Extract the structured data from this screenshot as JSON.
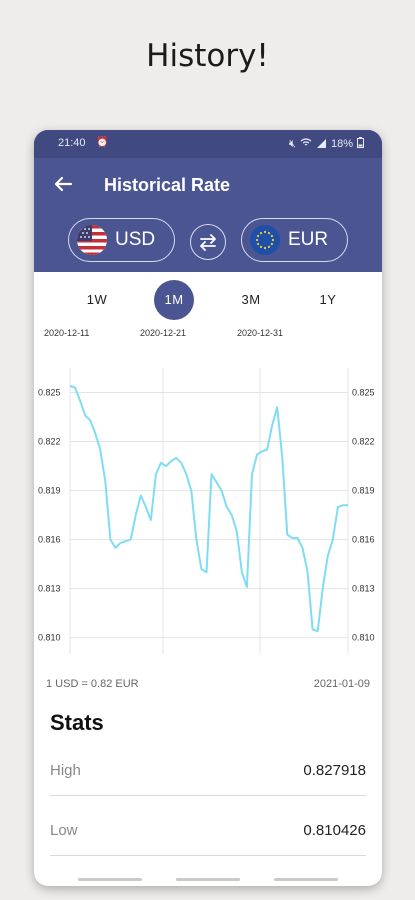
{
  "headline": "History!",
  "status": {
    "time": "21:40",
    "alarm_icon": "alarm-icon",
    "battery": "18%"
  },
  "header": {
    "title": "Historical Rate",
    "back_icon": "arrow-left-icon"
  },
  "currencies": {
    "from": {
      "code": "USD",
      "flag": "us-flag-icon"
    },
    "to": {
      "code": "EUR",
      "flag": "eu-flag-icon"
    },
    "swap_icon": "swap-arrows-icon"
  },
  "ranges": [
    {
      "label": "1W",
      "active": false
    },
    {
      "label": "1M",
      "active": true
    },
    {
      "label": "3M",
      "active": false
    },
    {
      "label": "1Y",
      "active": false
    }
  ],
  "colors": {
    "header": "#4b5591",
    "status_bar": "#414a80",
    "line": "#7fdcf4",
    "background": "#efedeb"
  },
  "chart_data": {
    "type": "line",
    "x_ticks": [
      "2020-12-11",
      "2020-12-21",
      "2020-12-31"
    ],
    "y_ticks": [
      "0.825",
      "0.822",
      "0.819",
      "0.816",
      "0.813",
      "0.810"
    ],
    "ylim": [
      0.809,
      0.8265
    ],
    "xlim": [
      0,
      29
    ],
    "grid": true,
    "series": [
      {
        "values": [
          0.8254,
          0.8253,
          0.8245,
          0.8236,
          0.8233,
          0.8225,
          0.8215,
          0.8195,
          0.816,
          0.8155,
          0.8158,
          0.8159,
          0.816,
          0.8175,
          0.8187,
          0.818,
          0.8172,
          0.82,
          0.8207,
          0.8205,
          0.8208,
          0.821,
          0.8207,
          0.82,
          0.819,
          0.816,
          0.8142,
          0.814,
          0.82,
          0.8195,
          0.819,
          0.818,
          0.8175,
          0.8165,
          0.814,
          0.8131,
          0.82,
          0.8212,
          0.8214,
          0.8215,
          0.823,
          0.8241,
          0.821,
          0.8163,
          0.8161,
          0.8161,
          0.8155,
          0.814,
          0.8105,
          0.8104,
          0.813,
          0.815,
          0.816,
          0.818,
          0.8181,
          0.8181
        ]
      }
    ]
  },
  "footer_meta": {
    "rate": "1 USD = 0.82 EUR",
    "date": "2021-01-09"
  },
  "stats": {
    "title": "Stats",
    "rows": [
      {
        "label": "High",
        "value": "0.827918"
      },
      {
        "label": "Low",
        "value": "0.810426"
      }
    ]
  }
}
